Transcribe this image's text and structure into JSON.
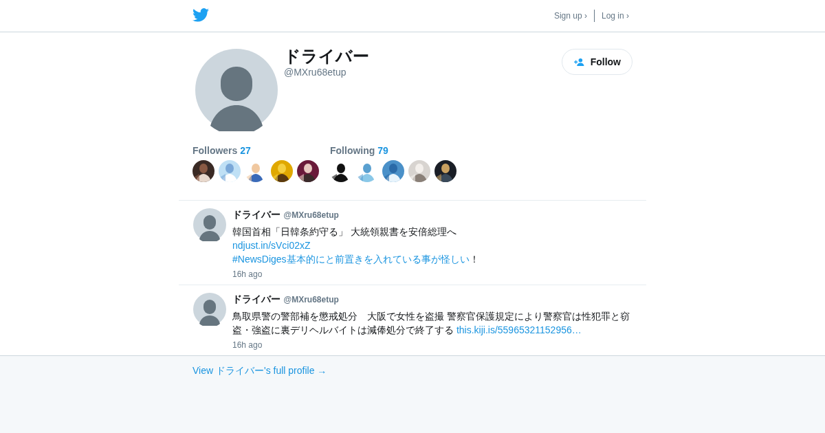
{
  "header": {
    "links": [
      "Sign up ›",
      "Log in ›"
    ]
  },
  "profile": {
    "name": "ドライバー",
    "handle": "@MXru68etup",
    "follow_button": "Follow"
  },
  "stats": [
    {
      "label": "Followers",
      "count": "27"
    },
    {
      "label": "Following",
      "count": "79"
    }
  ],
  "tweets": [
    {
      "name": "ドライバー",
      "handle": "@MXru68etup",
      "lines": [
        [
          {
            "kind": "text",
            "text": "韓国首相「日韓条約守る」 大統領親書を安倍総理へ"
          }
        ],
        [
          {
            "kind": "link",
            "text": "ndjust.in/sVci02xZ"
          }
        ],
        [
          {
            "kind": "hashtag",
            "text": "#NewsDiges基本的にと前置きを入れている事が怪しい"
          },
          {
            "kind": "text",
            "text": "！"
          }
        ]
      ],
      "time": "16h ago"
    },
    {
      "name": "ドライバー",
      "handle": "@MXru68etup",
      "lines": [
        [
          {
            "kind": "text",
            "text": "鳥取県警の警部補を懲戒処分　大阪で女性を盗撮 警察官保護規定により警察官は性犯罪と窃盗・強盗に裏デリヘルバイトは減俸処分で終了する "
          },
          {
            "kind": "link",
            "text": "this.kiji.is/55965321152956…"
          }
        ]
      ],
      "time": "16h ago"
    }
  ],
  "footer": {
    "link": "View ドライバー's full profile →"
  }
}
